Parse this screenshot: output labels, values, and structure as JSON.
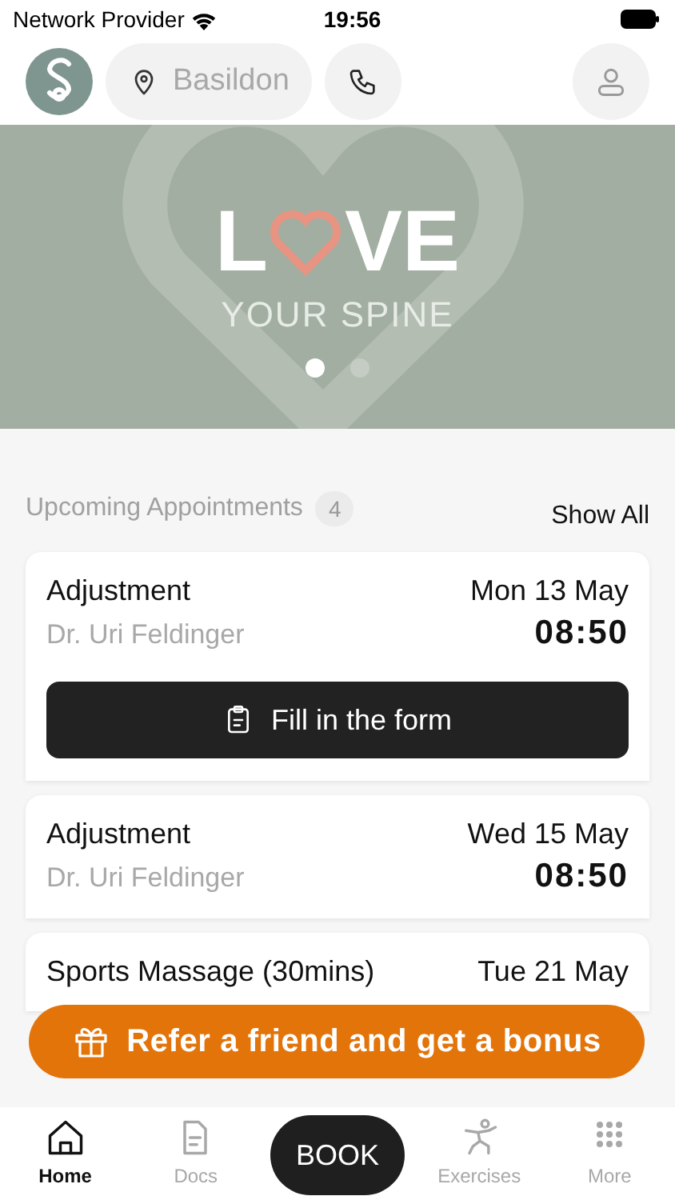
{
  "status_bar": {
    "carrier": "Network Provider",
    "time": "19:56"
  },
  "header": {
    "location": "Basildon"
  },
  "banner": {
    "word_start": "L",
    "word_end": "VE",
    "subtitle": "YOUR SPINE",
    "dots": [
      {
        "selected": true
      },
      {
        "selected": false
      }
    ]
  },
  "appointments": {
    "title": "Upcoming Appointments",
    "count": "4",
    "show_all": "Show All",
    "items": [
      {
        "service": "Adjustment",
        "practitioner": "Dr. Uri Feldinger",
        "date": "Mon 13 May",
        "time": "08:50",
        "action": "Fill in the form"
      },
      {
        "service": "Adjustment",
        "practitioner": "Dr. Uri Feldinger",
        "date": "Wed 15 May",
        "time": "08:50"
      },
      {
        "service": "Sports Massage (30mins)",
        "date": "Tue 21 May"
      }
    ]
  },
  "refer_button": "Refer a friend and get a bonus",
  "tab_bar": [
    {
      "label": "Home",
      "kind": "home",
      "selected": true
    },
    {
      "label": "Docs",
      "kind": "docs",
      "selected": false
    },
    {
      "label": "BOOK",
      "kind": "book",
      "selected": false
    },
    {
      "label": "Exercises",
      "kind": "exercises",
      "selected": false
    },
    {
      "label": "More",
      "kind": "more",
      "selected": false
    }
  ]
}
